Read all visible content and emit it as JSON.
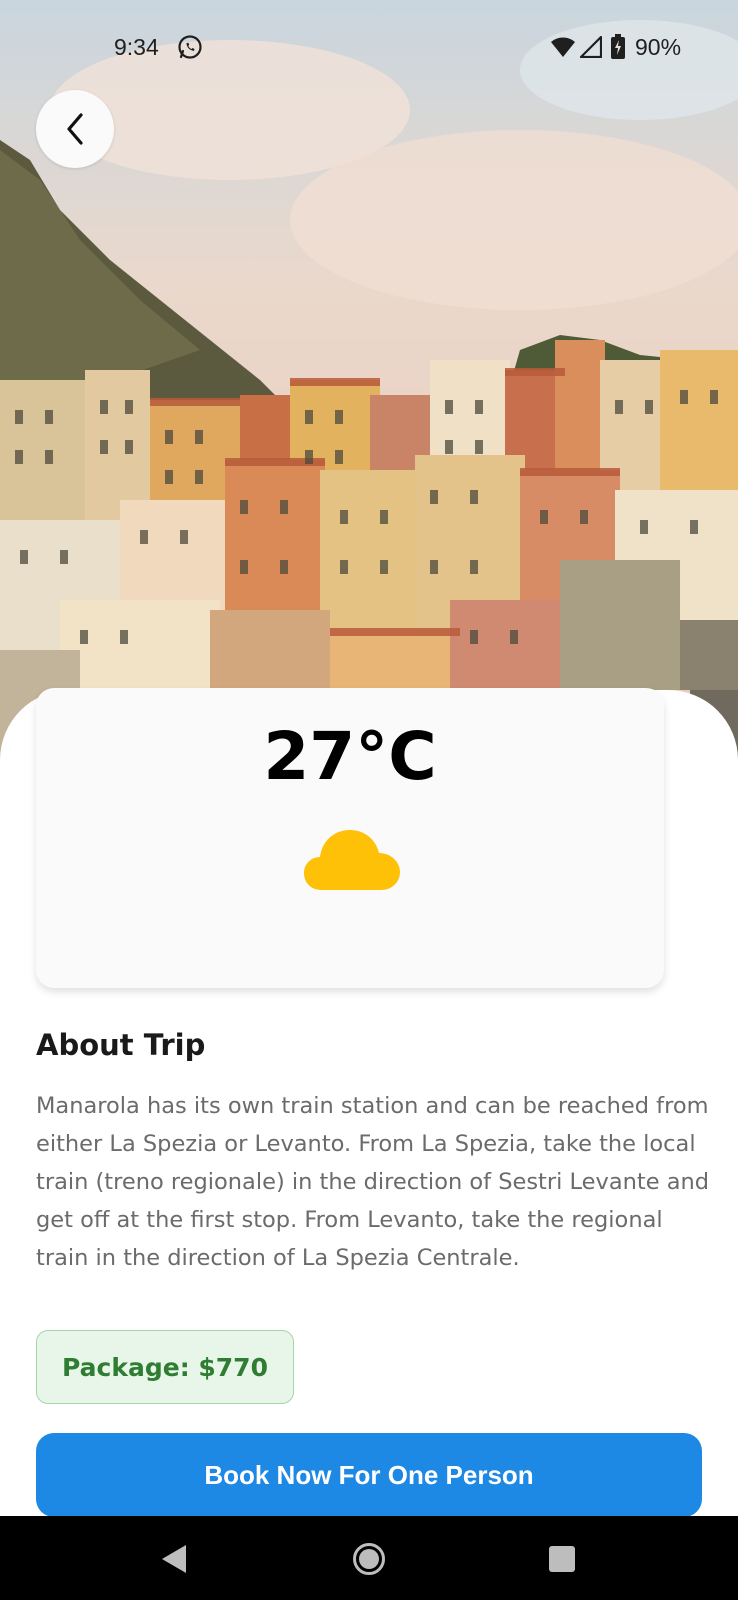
{
  "status_bar": {
    "time": "9:34",
    "battery": "90%",
    "icons": [
      "whatsapp-icon",
      "wifi-icon",
      "signal-icon",
      "battery-charging-icon"
    ]
  },
  "header": {
    "back_icon": "chevron-left-icon"
  },
  "hero": {
    "description_icon": "hero-image"
  },
  "weather": {
    "temperature": "27°C",
    "condition_icon": "cloud-icon",
    "icon_color": "#ffc107"
  },
  "about": {
    "title": "About Trip",
    "text": "Manarola has its own train station and can be reached from either La Spezia or Levanto. From La Spezia, take the local train (treno regionale) in the direction of Sestri Levante and get off at the first stop. From Levanto, take the regional train in the direction of La Spezia Centrale."
  },
  "package": {
    "label": "Package: $770",
    "text_color": "#2e7d32",
    "bg_color": "#e8f5e9"
  },
  "book_button": {
    "label": "Book Now For One Person",
    "color": "#1e88e5"
  },
  "nav_bar": {
    "icons": [
      "nav-back-icon",
      "nav-home-icon",
      "nav-recent-icon"
    ]
  }
}
